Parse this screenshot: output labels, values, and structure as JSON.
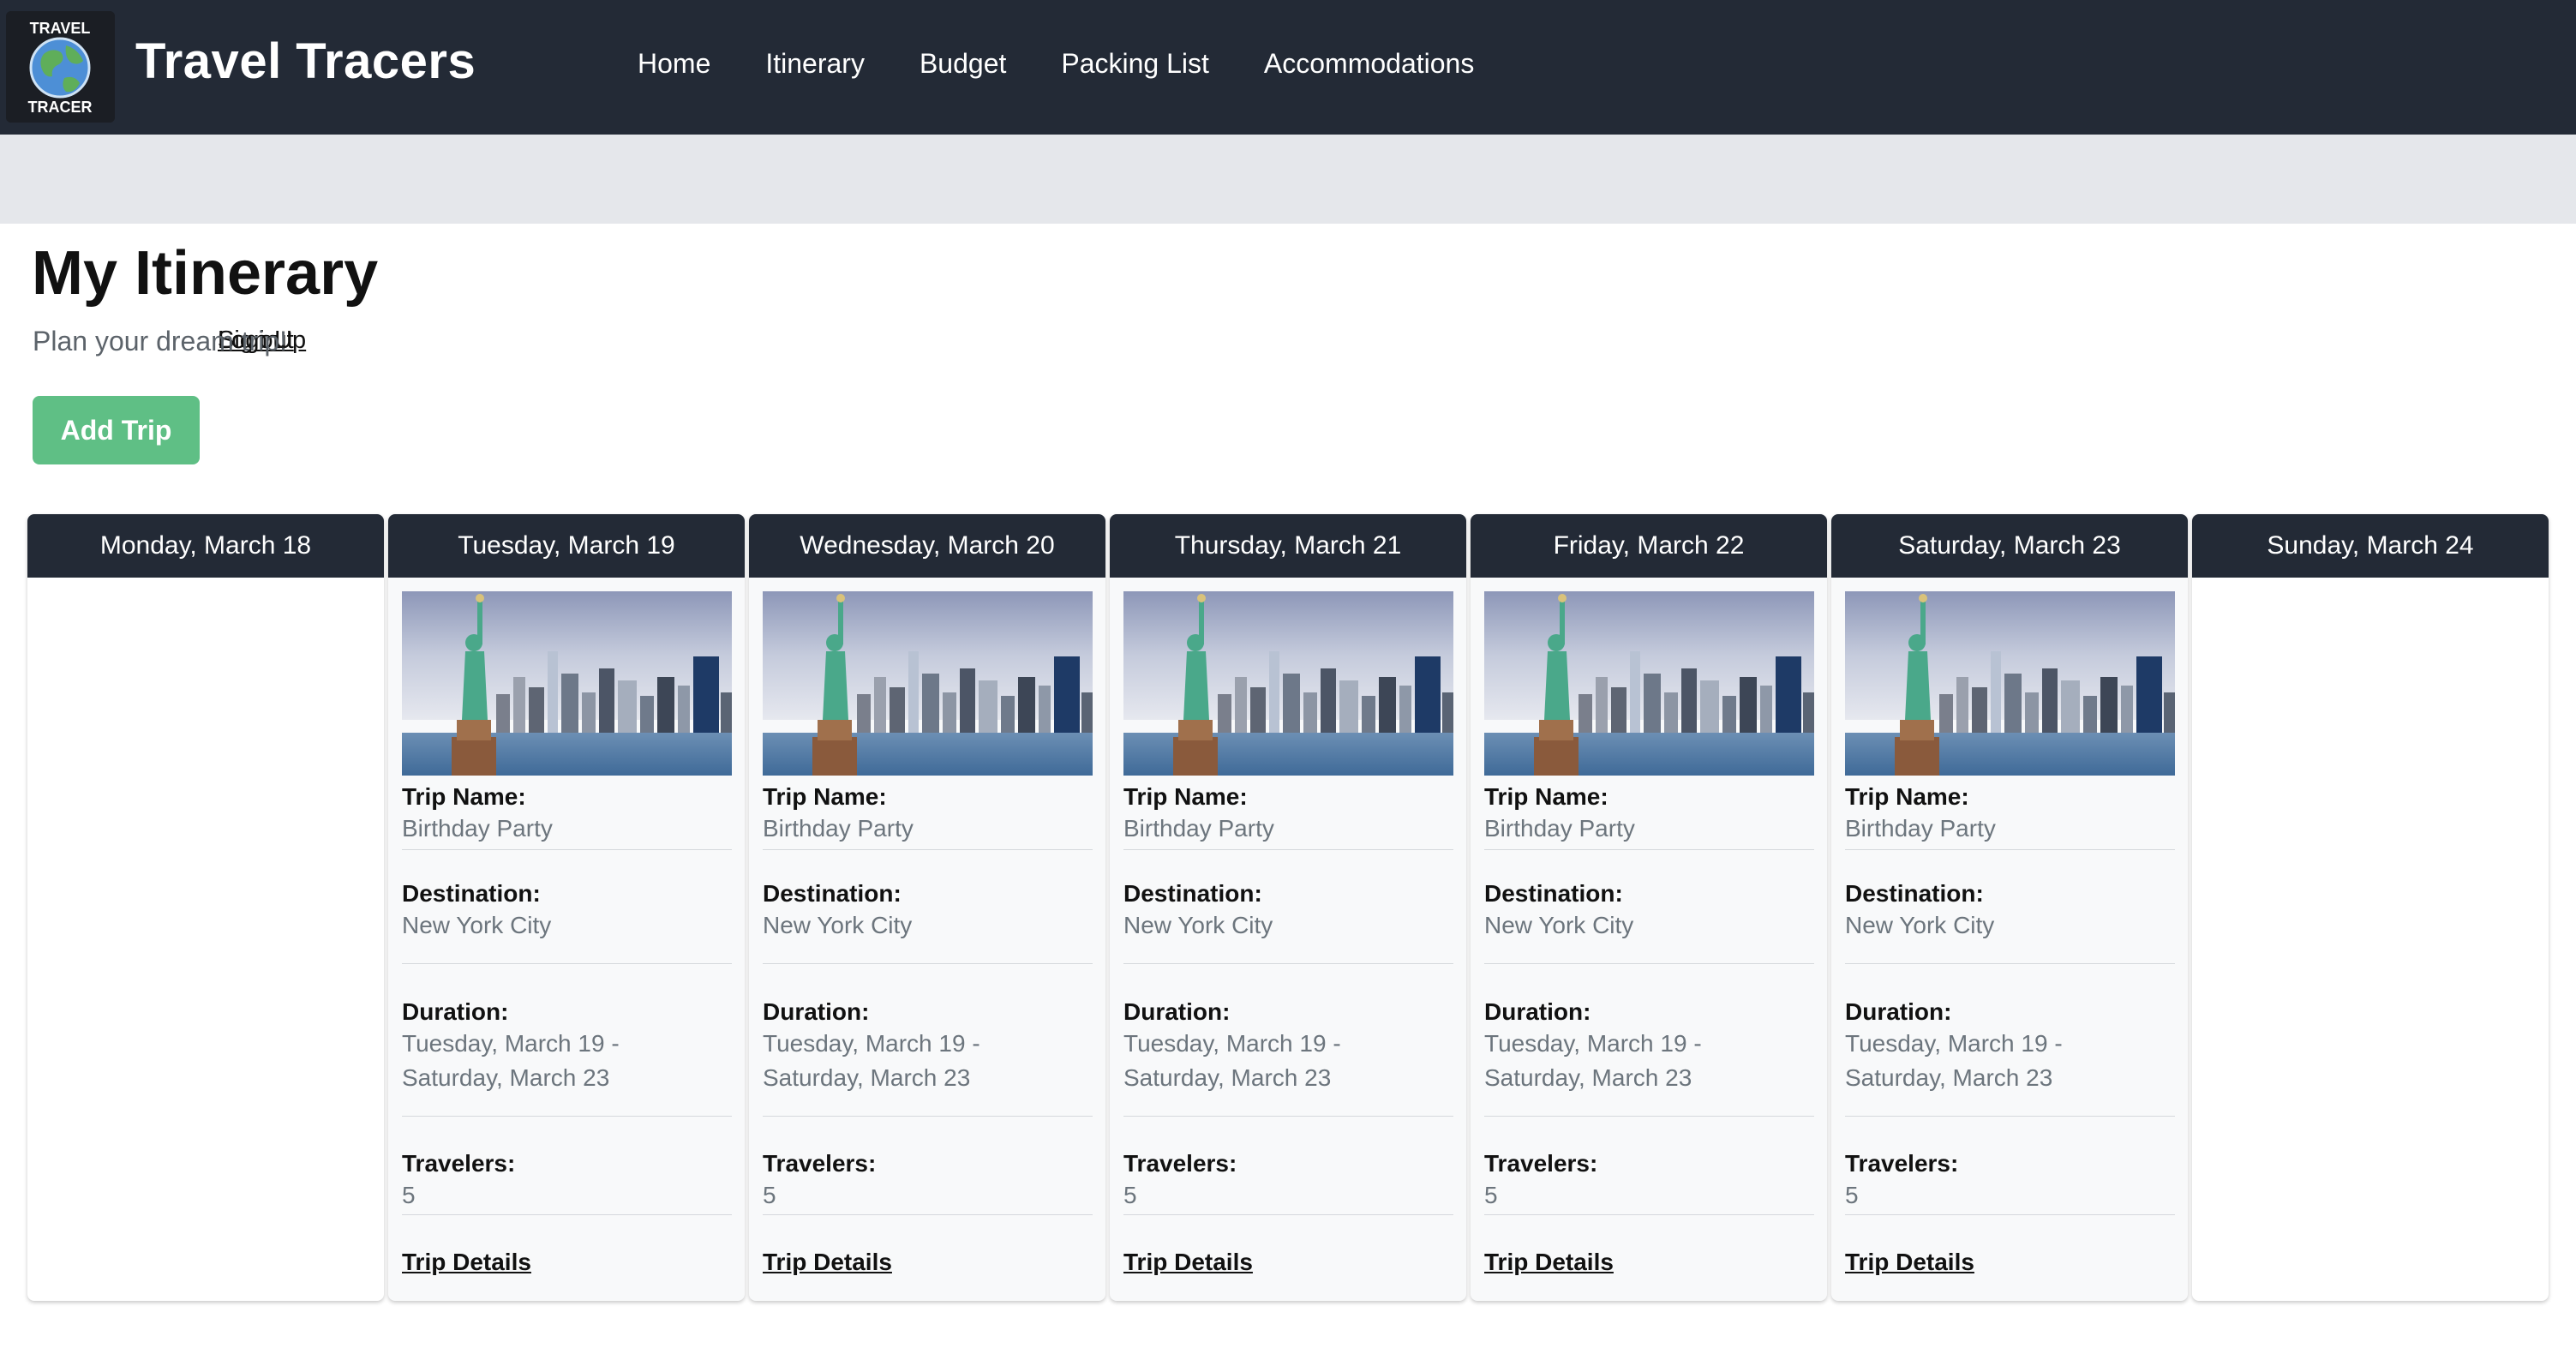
{
  "brand": {
    "name": "Travel Tracers",
    "logo_top_text": "TRAVEL",
    "logo_bottom_text": "TRACER"
  },
  "nav": [
    "Home",
    "Itinerary",
    "Budget",
    "Packing List",
    "Accommodations"
  ],
  "auth": [
    "Sign Up",
    "Login",
    "Logout"
  ],
  "page": {
    "title": "My Itinerary",
    "subtitle": "Plan your dream trip!",
    "add_button": "Add Trip"
  },
  "labels": {
    "trip_name": "Trip Name:",
    "destination": "Destination:",
    "duration": "Duration:",
    "travelers": "Travelers:",
    "details_link": "Trip Details"
  },
  "trip": {
    "name": "Birthday Party",
    "destination": "New York City",
    "duration_start": "Tuesday, March 19 -",
    "duration_end": "Saturday, March 23",
    "travelers": "5"
  },
  "days": [
    {
      "label": "Monday, March 18",
      "has_trip": false
    },
    {
      "label": "Tuesday, March 19",
      "has_trip": true
    },
    {
      "label": "Wednesday, March 20",
      "has_trip": true
    },
    {
      "label": "Thursday, March 21",
      "has_trip": true
    },
    {
      "label": "Friday, March 22",
      "has_trip": true
    },
    {
      "label": "Saturday, March 23",
      "has_trip": true
    },
    {
      "label": "Sunday, March 24",
      "has_trip": false
    }
  ],
  "colors": {
    "header": "#232a36",
    "subbar": "#e5e7eb",
    "button": "#5fbf85",
    "muted_text": "#6c757d"
  },
  "icons": {
    "logo": "globe-logo-icon",
    "trip_image": "statue-of-liberty-image"
  }
}
